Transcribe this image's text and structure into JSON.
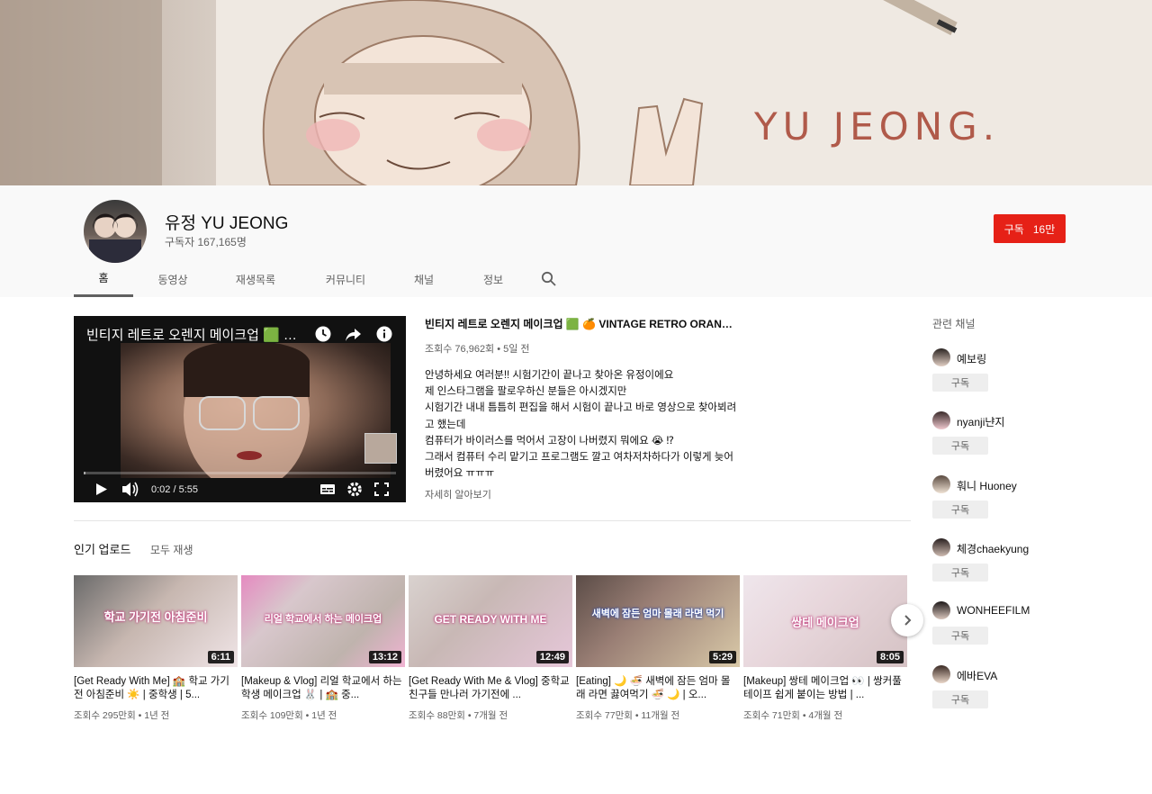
{
  "banner": {
    "text": "YU JEONG."
  },
  "channel": {
    "name": "유정 YU JEONG",
    "subscribers": "구독자 167,165명",
    "subscribe_label": "구독",
    "subscribe_count": "16만"
  },
  "tabs": [
    {
      "label": "홈",
      "active": true
    },
    {
      "label": "동영상"
    },
    {
      "label": "재생목록"
    },
    {
      "label": "커뮤니티"
    },
    {
      "label": "채널"
    },
    {
      "label": "정보"
    }
  ],
  "featured": {
    "player_title": "빈티지 레트로 오렌지 메이크업 🟩 🍊 ...",
    "time": "0:02 / 5:55",
    "progress_fraction": 0.006,
    "title": "빈티지 레트로 오렌지 메이크업 🟩 🍊  VINTAGE RETRO ORANGE ...",
    "meta": "조회수 76,962회 • 5일 전",
    "description": [
      "안녕하세요 여러분!! 시험기간이 끝나고 찾아온 유정이에요",
      "제 인스타그램을 팔로우하신 분들은 아시겠지만",
      "시험기간 내내 틈틈히 편집을 해서 시험이 끝나고 바로 영상으로 찾아뵈려",
      "고 했는데",
      "컴퓨터가 바이러스를 먹어서 고장이 나버렸지 뭐에요 😭 ⁉",
      "그래서 컴퓨터 수리 맡기고 프로그램도 깔고 여차저차하다가 이렇게 늦어",
      "버렸어요 ㅠㅠㅠ"
    ],
    "more_label": "자세히 알아보기"
  },
  "shelf": {
    "title": "인기 업로드",
    "play_all": "모두 재생",
    "videos": [
      {
        "title": "[Get Ready With Me] 🏫 학교 가기전 아침준비 ☀️ | 중학생 | 5...",
        "meta": "조회수 295만회 • 1년 전",
        "duration": "6:11",
        "caption": "학교 가기전 아침준비"
      },
      {
        "title": "[Makeup & Vlog] 리얼 학교에서 하는 학생 메이크업 🐰 | 🏫 중...",
        "meta": "조회수 109만회 • 1년 전",
        "duration": "13:12",
        "caption": "리얼 학교에서 하는 메이크업"
      },
      {
        "title": "[Get Ready With Me & Vlog] 중학교 친구들 만나러 가기전에 ...",
        "meta": "조회수 88만회 • 7개월 전",
        "duration": "12:49",
        "caption": "GET READY WITH ME"
      },
      {
        "title": "[Eating] 🌙 🍜 새벽에 잠든 엄마 몰래 라면 끓여먹기 🍜 🌙 | 오...",
        "meta": "조회수 77만회 • 11개월 전",
        "duration": "5:29",
        "caption": "새벽에 잠든 엄마 몰래 라면 먹기"
      },
      {
        "title": "[Makeup] 쌍테 메이크업 👀 | 쌍커풀 테이프 쉽게 붙이는 방법 | ...",
        "meta": "조회수 71만회 • 4개월 전",
        "duration": "8:05",
        "caption": "쌍테 메이크업"
      }
    ]
  },
  "related": {
    "title": "관련 채널",
    "subscribe_label": "구독",
    "channels": [
      {
        "name": "예보링"
      },
      {
        "name": "nyanji냔지"
      },
      {
        "name": "훠니 Huoney"
      },
      {
        "name": "체경chaekyung"
      },
      {
        "name": "WONHEEFILM"
      },
      {
        "name": "에바EVA"
      }
    ]
  },
  "icons": {
    "search": "search-icon",
    "play": "play-icon",
    "volume": "volume-icon",
    "subtitles": "subtitles-icon",
    "settings": "gear-icon",
    "fullscreen": "fullscreen-icon",
    "watch_later": "clock-icon",
    "share": "share-icon",
    "info": "info-icon",
    "next": "chevron-right-icon"
  },
  "colors": {
    "subscribe": "#e62117",
    "text_secondary": "#606060"
  }
}
